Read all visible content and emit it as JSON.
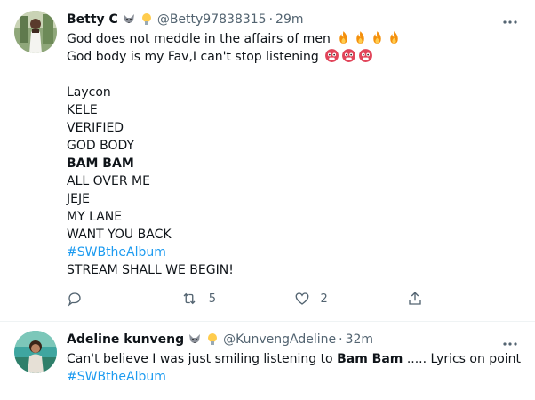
{
  "tweets": [
    {
      "name": "Betty C",
      "handle": "@Betty97838315",
      "dot": "·",
      "time": "29m",
      "lines": {
        "l1": "God does not meddle in the affairs of men",
        "l2": "God body is my Fav,I can't stop listening",
        "l3": "Laycon",
        "l4": "KELE",
        "l5": "VERIFIED",
        "l6": "GOD BODY",
        "l7": "BAM BAM",
        "l8": "ALL OVER ME",
        "l9": "JEJE",
        "l10": "MY LANE",
        "l11": "WANT YOU BACK",
        "l12": "#SWBtheAlbum",
        "l13": "STREAM SHALL WE BEGIN!"
      },
      "retweet_count": "5",
      "like_count": "2"
    },
    {
      "name": "Adeline kunveng",
      "handle": "@KunvengAdeline",
      "dot": "·",
      "time": "32m",
      "text_before": "Can't believe I was just smiling listening to ",
      "text_bold": "Bam Bam",
      "text_after": " ..... Lyrics on point",
      "hashtag": "#SWBtheAlbum"
    }
  ],
  "icons": {
    "badge_wolf": "wolf-emoji-icon",
    "badge_bulb": "lightbulb-emoji-icon",
    "fire": "fire-emoji-icon",
    "hot_face": "hot-face-emoji-icon",
    "reply": "reply-icon",
    "retweet": "retweet-icon",
    "like": "heart-icon",
    "share": "share-icon",
    "more": "more-icon"
  },
  "colors": {
    "hashtag": "#1d9bf0",
    "secondary_text": "#536471",
    "divider": "#eff3f4"
  }
}
